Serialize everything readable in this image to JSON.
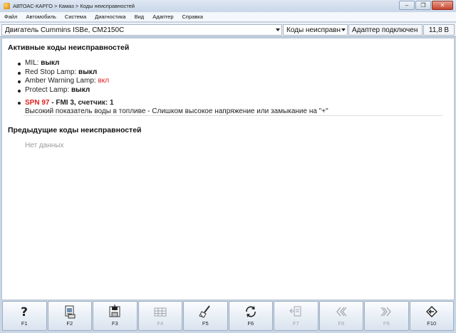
{
  "window": {
    "title": "АВТОАС-КАРГО > Камаз > Коды неисправностей",
    "controls": [
      "‒",
      "❐",
      "✕"
    ]
  },
  "menu": [
    "Файл",
    "Автомобиль",
    "Система",
    "Диагностика",
    "Вид",
    "Адаптер",
    "Справка"
  ],
  "toolbar": {
    "engine": "Двигатель Cummins ISBe, CM2150C",
    "view": "Коды неисправн",
    "adapter": "Адаптер подключен",
    "voltage": "11,8 В"
  },
  "active": {
    "title": "Активные коды неисправностей",
    "lamps": [
      {
        "label": "MIL: ",
        "value": "выкл",
        "on": false
      },
      {
        "label": "Red Stop Lamp: ",
        "value": "выкл",
        "on": false
      },
      {
        "label": "Amber Warning Lamp: ",
        "value": "вкл",
        "on": true
      },
      {
        "label": "Protect Lamp: ",
        "value": "выкл",
        "on": false
      }
    ],
    "fault": {
      "spn": "SPN 97",
      "rest": " - FMI 3, счетчик: 1",
      "description": "Высокий показатель воды в топливе - Слишком высокое напряжение или замыкание на \"+\""
    }
  },
  "previous": {
    "title": "Предыдущие коды неисправностей",
    "empty": "Нет данных"
  },
  "fkeys": [
    {
      "label": "F1",
      "icon": "help-icon",
      "enabled": true
    },
    {
      "label": "F2",
      "icon": "report-icon",
      "enabled": true
    },
    {
      "label": "F3",
      "icon": "save-icon",
      "enabled": true
    },
    {
      "label": "F4",
      "icon": "table-icon",
      "enabled": false
    },
    {
      "label": "F5",
      "icon": "clear-icon",
      "enabled": true
    },
    {
      "label": "F6",
      "icon": "refresh-icon",
      "enabled": true
    },
    {
      "label": "F7",
      "icon": "export-icon",
      "enabled": false
    },
    {
      "label": "F8",
      "icon": "rewind-icon",
      "enabled": false
    },
    {
      "label": "F9",
      "icon": "forward-icon",
      "enabled": false
    },
    {
      "label": "F10",
      "icon": "exit-icon",
      "enabled": true
    }
  ]
}
